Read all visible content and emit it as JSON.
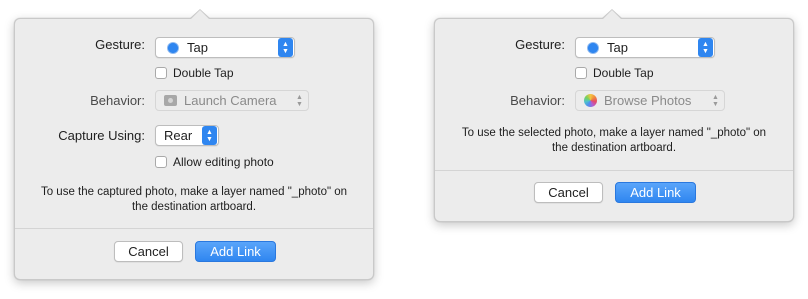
{
  "popover_camera": {
    "gesture_label": "Gesture:",
    "gesture_value": "Tap",
    "double_tap_label": "Double Tap",
    "behavior_label": "Behavior:",
    "behavior_value": "Launch Camera",
    "capture_label": "Capture Using:",
    "capture_value": "Rear",
    "allow_editing_label": "Allow editing photo",
    "info_line1": "To use the captured photo, make a layer named \"_photo\" on",
    "info_line2": "the destination artboard.",
    "cancel_label": "Cancel",
    "add_link_label": "Add Link"
  },
  "popover_photos": {
    "gesture_label": "Gesture:",
    "gesture_value": "Tap",
    "double_tap_label": "Double Tap",
    "behavior_label": "Behavior:",
    "behavior_value": "Browse Photos",
    "info_line1": "To use the selected photo, make a layer named \"_photo\" on",
    "info_line2": "the destination artboard.",
    "cancel_label": "Cancel",
    "add_link_label": "Add Link"
  },
  "icons": {
    "gesture": "tap-radio-icon",
    "camera": "camera-icon",
    "photos": "photos-app-icon",
    "stepper": "up-down-chevron-icon"
  },
  "colors": {
    "accent": "#2f86f0",
    "panel_bg": "#ececec",
    "disabled_text": "#8a8a8a"
  }
}
